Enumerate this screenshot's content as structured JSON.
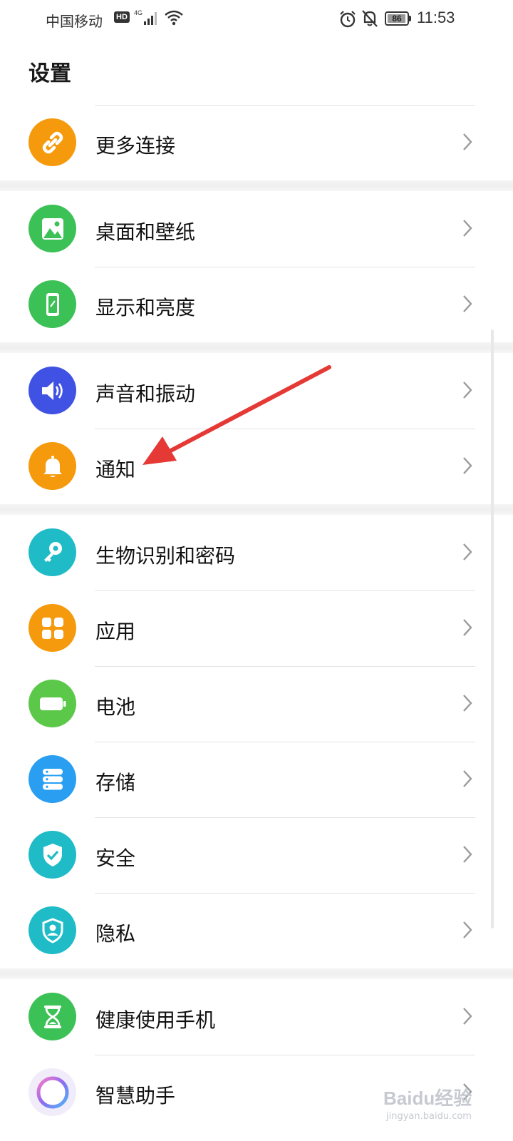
{
  "status_bar": {
    "carrier": "中国移动",
    "hd": "HD",
    "network": "4G",
    "battery_level": "86",
    "time": "11:53"
  },
  "page": {
    "title": "设置"
  },
  "groups": [
    {
      "items": [
        {
          "label": "更多连接",
          "icon": "link-icon",
          "color": "#f59a0c"
        }
      ]
    },
    {
      "items": [
        {
          "label": "桌面和壁纸",
          "icon": "wallpaper-icon",
          "color": "#3cc156"
        },
        {
          "label": "显示和亮度",
          "icon": "display-icon",
          "color": "#3cc156"
        }
      ]
    },
    {
      "items": [
        {
          "label": "声音和振动",
          "icon": "sound-icon",
          "color": "#3f52e3"
        },
        {
          "label": "通知",
          "icon": "bell-icon",
          "color": "#f59a0c"
        }
      ]
    },
    {
      "items": [
        {
          "label": "生物识别和密码",
          "icon": "key-icon",
          "color": "#1fbcc7"
        },
        {
          "label": "应用",
          "icon": "apps-icon",
          "color": "#f59a0c"
        },
        {
          "label": "电池",
          "icon": "battery-icon",
          "color": "#5cc84a"
        },
        {
          "label": "存储",
          "icon": "storage-icon",
          "color": "#2a9ff2"
        },
        {
          "label": "安全",
          "icon": "shield-check-icon",
          "color": "#1fbcc7"
        },
        {
          "label": "隐私",
          "icon": "privacy-icon",
          "color": "#1fbcc7"
        }
      ]
    },
    {
      "items": [
        {
          "label": "健康使用手机",
          "icon": "hourglass-icon",
          "color": "#3cc156"
        },
        {
          "label": "智慧助手",
          "icon": "assistant-icon",
          "color": "#a07cf0"
        }
      ]
    }
  ],
  "watermark": {
    "text": "Baidu经验",
    "sub": "jingyan.baidu.com"
  },
  "colors": {
    "annotation_arrow": "#e53935",
    "accent_orange": "#f59a0c",
    "accent_green": "#3cc156"
  }
}
